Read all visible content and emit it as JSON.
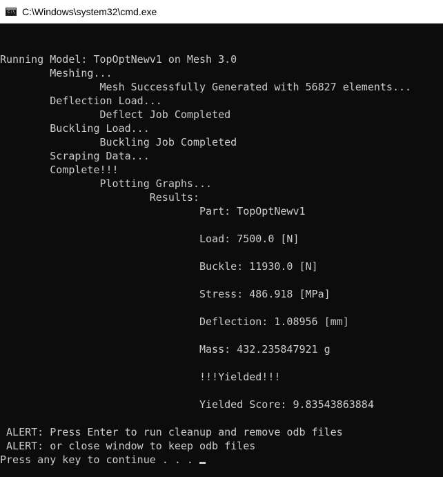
{
  "window": {
    "title": "C:\\Windows\\system32\\cmd.exe",
    "icon": "cmd-console-icon",
    "icon_glyph": "C:\\"
  },
  "console": {
    "lines": [
      "",
      "Running Model: TopOptNewv1 on Mesh 3.0",
      "        Meshing...",
      "                Mesh Successfully Generated with 56827 elements...",
      "        Deflection Load...",
      "                Deflect Job Completed",
      "        Buckling Load...",
      "                Buckling Job Completed",
      "        Scraping Data...",
      "        Complete!!!",
      "                Plotting Graphs...",
      "                        Results:",
      "                                Part: TopOptNewv1",
      "",
      "                                Load: 7500.0 [N]",
      "",
      "                                Buckle: 11930.0 [N]",
      "",
      "                                Stress: 486.918 [MPa]",
      "",
      "                                Deflection: 1.08956 [mm]",
      "",
      "                                Mass: 432.235847921 g",
      "",
      "                                !!!Yielded!!!",
      "",
      "                                Yielded Score: 9.83543863884",
      "",
      " ALERT: Press Enter to run cleanup and remove odb files",
      " ALERT: or close window to keep odb files",
      "Press any key to continue . . . "
    ]
  },
  "colors": {
    "background": "#0c0c0c",
    "text": "#cccccc",
    "titlebar": "#ffffff"
  }
}
